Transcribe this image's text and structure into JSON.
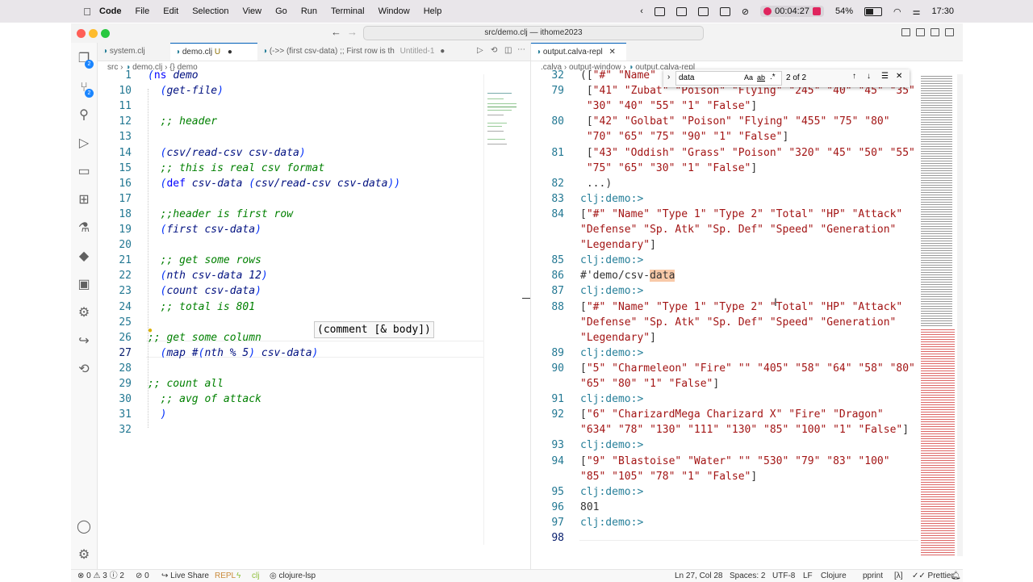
{
  "menubar": {
    "items": [
      "Code",
      "File",
      "Edit",
      "Selection",
      "View",
      "Go",
      "Run",
      "Terminal",
      "Window",
      "Help"
    ],
    "recording_time": "00:04:27",
    "battery": "54%",
    "clock": "17:30"
  },
  "window": {
    "command_center": "src/demo.clj — ithome2023"
  },
  "left_group": {
    "tabs": [
      {
        "label": "system.clj"
      },
      {
        "label": "demo.clj",
        "decoration": "U"
      },
      {
        "label": "(->> (first csv-data) ;; First row is th",
        "suffix": "Untitled-1"
      }
    ],
    "breadcrumb": [
      "src",
      "demo.clj",
      "{} demo"
    ],
    "lines": [
      {
        "n": "1",
        "text": "(ns demo"
      },
      {
        "n": "10",
        "text": "  (get-file)"
      },
      {
        "n": "11",
        "text": ""
      },
      {
        "n": "12",
        "text": "  ;; header"
      },
      {
        "n": "13",
        "text": ""
      },
      {
        "n": "14",
        "text": "  (csv/read-csv csv-data)"
      },
      {
        "n": "15",
        "text": "  ;; this is real csv format"
      },
      {
        "n": "16",
        "text": "  (def csv-data (csv/read-csv csv-data))"
      },
      {
        "n": "17",
        "text": ""
      },
      {
        "n": "18",
        "text": "  ;;header is first row"
      },
      {
        "n": "19",
        "text": "  (first csv-data)"
      },
      {
        "n": "20",
        "text": ""
      },
      {
        "n": "21",
        "text": "  ;; get some rows"
      },
      {
        "n": "22",
        "text": "  (nth csv-data 12)"
      },
      {
        "n": "23",
        "text": "  (count csv-data)"
      },
      {
        "n": "24",
        "text": "  ;; total is 801"
      },
      {
        "n": "25",
        "text": ""
      },
      {
        "n": "26",
        "text": ";; get some column"
      },
      {
        "n": "27",
        "text": "  (map #(nth % 5) csv-data)"
      },
      {
        "n": "28",
        "text": ""
      },
      {
        "n": "29",
        "text": ";; count all"
      },
      {
        "n": "30",
        "text": "  ;; avg of attack"
      },
      {
        "n": "31",
        "text": "  )"
      },
      {
        "n": "32",
        "text": ""
      }
    ],
    "tooltip": "(comment [& body])"
  },
  "right_group": {
    "tabs": [
      {
        "label": "output.calva-repl"
      }
    ],
    "breadcrumb": [
      ".calva",
      "output-window",
      "output.calva-repl"
    ],
    "find": {
      "query": "data",
      "result": "2 of 2"
    },
    "lines": [
      {
        "n": "32",
        "text": "([\"#\" \"Name\" \"Type 1\" \"Type 2\""
      },
      {
        "n": "79",
        "text": " [\"41\" \"Zubat\" \"Poison\" \"Flying\" \"245\" \"40\" \"45\" \"35\""
      },
      {
        "n": "",
        "text": " \"30\" \"40\" \"55\" \"1\" \"False\"]"
      },
      {
        "n": "80",
        "text": " [\"42\" \"Golbat\" \"Poison\" \"Flying\" \"455\" \"75\" \"80\""
      },
      {
        "n": "",
        "text": " \"70\" \"65\" \"75\" \"90\" \"1\" \"False\"]"
      },
      {
        "n": "81",
        "text": " [\"43\" \"Oddish\" \"Grass\" \"Poison\" \"320\" \"45\" \"50\" \"55\""
      },
      {
        "n": "",
        "text": " \"75\" \"65\" \"30\" \"1\" \"False\"]"
      },
      {
        "n": "82",
        "text": " ...)"
      },
      {
        "n": "83",
        "text": "clj:demo:>"
      },
      {
        "n": "84",
        "text": "[\"#\" \"Name\" \"Type 1\" \"Type 2\" \"Total\" \"HP\" \"Attack\""
      },
      {
        "n": "",
        "text": "\"Defense\" \"Sp. Atk\" \"Sp. Def\" \"Speed\" \"Generation\""
      },
      {
        "n": "",
        "text": "\"Legendary\"]"
      },
      {
        "n": "85",
        "text": "clj:demo:>"
      },
      {
        "n": "86",
        "text": "#'demo/csv-data"
      },
      {
        "n": "87",
        "text": "clj:demo:>"
      },
      {
        "n": "88",
        "text": "[\"#\" \"Name\" \"Type 1\" \"Type 2\" \"Total\" \"HP\" \"Attack\""
      },
      {
        "n": "",
        "text": "\"Defense\" \"Sp. Atk\" \"Sp. Def\" \"Speed\" \"Generation\""
      },
      {
        "n": "",
        "text": "\"Legendary\"]"
      },
      {
        "n": "89",
        "text": "clj:demo:>"
      },
      {
        "n": "90",
        "text": "[\"5\" \"Charmeleon\" \"Fire\" \"\" \"405\" \"58\" \"64\" \"58\" \"80\""
      },
      {
        "n": "",
        "text": "\"65\" \"80\" \"1\" \"False\"]"
      },
      {
        "n": "91",
        "text": "clj:demo:>"
      },
      {
        "n": "92",
        "text": "[\"6\" \"CharizardMega Charizard X\" \"Fire\" \"Dragon\""
      },
      {
        "n": "",
        "text": "\"634\" \"78\" \"130\" \"111\" \"130\" \"85\" \"100\" \"1\" \"False\"]"
      },
      {
        "n": "93",
        "text": "clj:demo:>"
      },
      {
        "n": "94",
        "text": "[\"9\" \"Blastoise\" \"Water\" \"\" \"530\" \"79\" \"83\" \"100\""
      },
      {
        "n": "",
        "text": "\"85\" \"105\" \"78\" \"1\" \"False\"]"
      },
      {
        "n": "95",
        "text": "clj:demo:>"
      },
      {
        "n": "96",
        "text": "801"
      },
      {
        "n": "97",
        "text": "clj:demo:>"
      },
      {
        "n": "98",
        "text": ""
      }
    ]
  },
  "statusbar": {
    "problems": "0",
    "warnings": "3",
    "info": "2",
    "ports": "0",
    "live_share": "Live Share",
    "repl": "REPL",
    "clj": "clj",
    "lsp": "clojure-lsp",
    "position": "Ln 27, Col 28",
    "spaces": "Spaces: 2",
    "encoding": "UTF-8",
    "eol": "LF",
    "language": "Clojure",
    "pprint": "pprint",
    "lambda": "[λ]",
    "prettier": "Prettier"
  },
  "colors": {
    "accent": "#005fb8",
    "badge": "#1a85ff",
    "record": "#e0245e",
    "find_match": "#f8c9a8"
  }
}
